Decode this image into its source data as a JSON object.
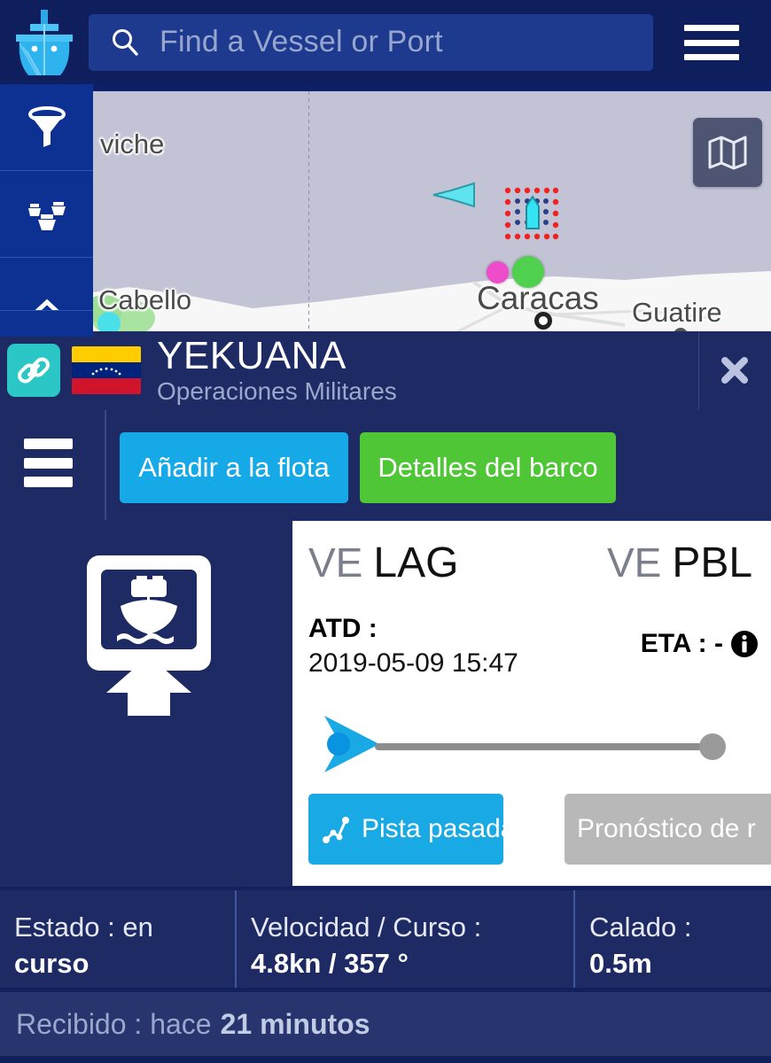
{
  "topbar": {
    "logo_icon": "marinetraffic-ship-logo",
    "search": {
      "icon": "search-icon",
      "placeholder": "Find a Vessel or Port",
      "value": ""
    },
    "menu_icon": "hamburger-menu-icon"
  },
  "sidebar": {
    "items": [
      {
        "icon": "filter-funnel-icon",
        "name": "filter"
      },
      {
        "icon": "fleet-ships-icon",
        "name": "fleets"
      },
      {
        "icon": "chevron-up-icon",
        "name": "more"
      }
    ]
  },
  "map": {
    "layers_button_icon": "map-layers-icon",
    "labels": [
      {
        "text": "viche"
      },
      {
        "text": "Cabello"
      },
      {
        "text": "Caracas"
      },
      {
        "text": "Guatire"
      }
    ],
    "markers": {
      "selected_vessel": "selected-vessel-marker",
      "other_vessel": "vessel-arrow-marker",
      "port_magenta": "port-marker",
      "port_green": "port-marker"
    }
  },
  "vessel": {
    "link_icon": "chain-link-icon",
    "flag": "venezuela-flag",
    "name": "YEKUANA",
    "subtitle": "Operaciones Militares",
    "close_icon": "close-icon"
  },
  "actions": {
    "menu_icon": "hamburger-menu-icon",
    "add_to_fleet": "Añadir a la flota",
    "ship_details": "Detalles del barco",
    "colors": {
      "add_to_fleet": "#16a9e8",
      "ship_details": "#4fc635"
    }
  },
  "voyage": {
    "photo_icon": "upload-ship-photo-icon",
    "from": {
      "country": "VE",
      "port": "LAG"
    },
    "to": {
      "country": "VE",
      "port": "PBL"
    },
    "atd_label": "ATD :",
    "atd_value": "2019-05-09 15:47",
    "eta_text": "ETA : -",
    "eta_info_icon": "info-icon",
    "progress_percent": 0,
    "track_button": {
      "label": "Pista pasada",
      "icon": "track-route-icon"
    },
    "forecast_button": {
      "label": "Pronóstico de r"
    }
  },
  "stats": [
    {
      "label": "Estado : en",
      "value": "curso"
    },
    {
      "label": "Velocidad / Curso :",
      "value": "4.8kn / 357 °"
    },
    {
      "label": "Calado :",
      "value": "0.5m"
    }
  ],
  "footer": {
    "label": "Recibido : hace",
    "value": "21 minutos"
  }
}
